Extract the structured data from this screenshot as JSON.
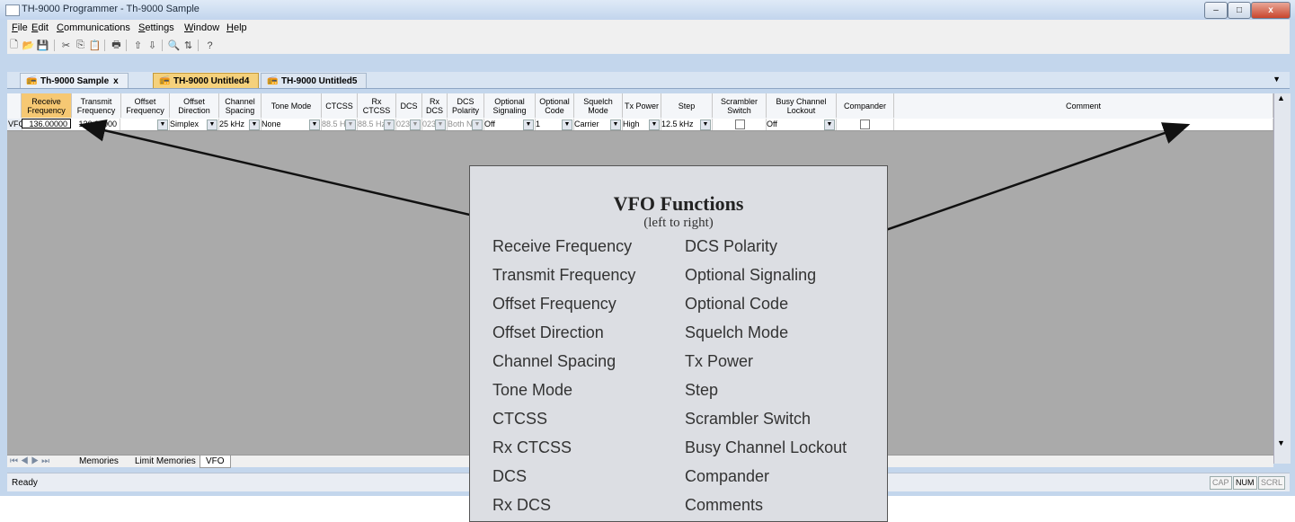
{
  "window": {
    "title": "TH-9000 Programmer - Th-9000 Sample",
    "min_label": "–",
    "max_label": "□",
    "close_label": "x"
  },
  "menu": [
    "File",
    "Edit",
    "Communications",
    "Settings",
    "Window",
    "Help"
  ],
  "toolbar_icons": [
    "new-icon",
    "open-icon",
    "save-icon",
    "cut-icon",
    "copy-icon",
    "paste-icon",
    "print-icon",
    "move-up-icon",
    "move-down-icon",
    "find-icon",
    "sort-icon",
    "help-icon"
  ],
  "tabs": [
    {
      "label": "Th-9000 Sample",
      "close": "x"
    },
    {
      "label": "TH-9000 Untitled4"
    },
    {
      "label": "TH-9000 Untitled5"
    }
  ],
  "grid": {
    "headers": [
      "Receive Frequency",
      "Transmit Frequency",
      "Offset Frequency",
      "Offset Direction",
      "Channel Spacing",
      "Tone Mode",
      "CTCSS",
      "Rx CTCSS",
      "DCS",
      "Rx DCS",
      "DCS Polarity",
      "Optional Signaling",
      "Optional Code",
      "Squelch Mode",
      "Tx Power",
      "Step",
      "Scrambler Switch",
      "Busy Channel Lockout",
      "Compander",
      "Comment"
    ],
    "row_label": "VFO",
    "row": [
      "136.00000",
      "136.00000",
      "",
      "Simplex",
      "25 kHz",
      "None",
      "88.5 Hz",
      "88.5 Hz",
      "023",
      "023",
      "Both N",
      "Off",
      "1",
      "Carrier",
      "High",
      "12.5 kHz",
      "",
      "Off",
      "",
      ""
    ]
  },
  "sheet_tabs": [
    "Memories",
    "Limit Memories",
    "VFO"
  ],
  "status": {
    "text": "Ready",
    "indicators": [
      "CAP",
      "NUM",
      "SCRL"
    ]
  },
  "callout": {
    "title": "VFO Functions",
    "subtitle": "(left to right)",
    "left": [
      "Receive Frequency",
      "Transmit Frequency",
      "Offset Frequency",
      "Offset Direction",
      "Channel Spacing",
      "Tone Mode",
      "CTCSS",
      "Rx CTCSS",
      "DCS",
      "Rx DCS"
    ],
    "right": [
      "DCS Polarity",
      "Optional Signaling",
      "Optional Code",
      "Squelch Mode",
      "Tx Power",
      "Step",
      "Scrambler Switch",
      "Busy Channel Lockout",
      "Compander",
      "Comments"
    ]
  }
}
